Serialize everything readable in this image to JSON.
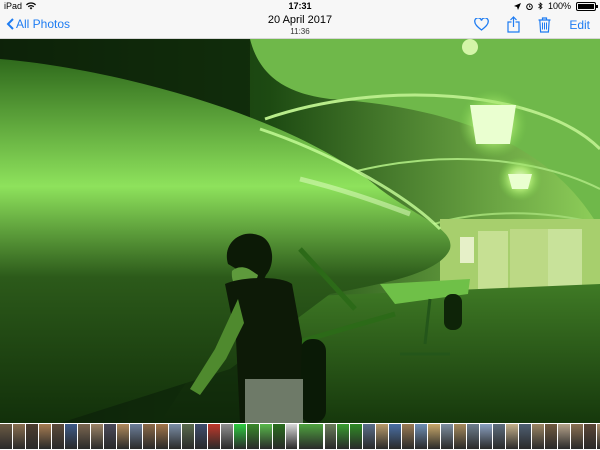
{
  "status_bar": {
    "device": "iPad",
    "time": "17:31",
    "battery": "100%",
    "battery_level": 1.0
  },
  "nav_bar": {
    "back_label": "All Photos",
    "date": "20 April 2017",
    "time": "11:36",
    "edit_label": "Edit"
  },
  "icons": {
    "back": "chevron-left-icon",
    "favorite": "heart-icon",
    "share": "share-icon",
    "delete": "trash-icon"
  },
  "colors": {
    "accent": "#1e7cf2",
    "bar_background": "#f7f7f7"
  },
  "filmstrip": {
    "thumbnails": [
      {
        "color": "#6b5a44"
      },
      {
        "color": "#8a6f50"
      },
      {
        "color": "#4d3d2f"
      },
      {
        "color": "#a67c52"
      },
      {
        "color": "#5c4a3a"
      },
      {
        "color": "#3e5a88"
      },
      {
        "color": "#7a6650"
      },
      {
        "color": "#9b8366"
      },
      {
        "color": "#4a4a5a"
      },
      {
        "color": "#b08a5c"
      },
      {
        "color": "#6d7f9a"
      },
      {
        "color": "#8c6a48"
      },
      {
        "color": "#a2754a"
      },
      {
        "color": "#7b8ea6"
      },
      {
        "color": "#5a6b4e"
      },
      {
        "color": "#3f4d6e"
      },
      {
        "color": "#c0392b"
      },
      {
        "color": "#8f8f8f"
      },
      {
        "color": "#2ecc40"
      },
      {
        "color": "#3a8a2a"
      },
      {
        "color": "#58b84a"
      },
      {
        "color": "#2a6e1e"
      },
      {
        "color": "#d8d8d8"
      },
      {
        "color": "#4fa33f",
        "current": true
      },
      {
        "color": "#6a7c5a"
      },
      {
        "color": "#3a9e30"
      },
      {
        "color": "#2f8a25"
      },
      {
        "color": "#5a6e8a"
      },
      {
        "color": "#b89a6a"
      },
      {
        "color": "#4a6fa5"
      },
      {
        "color": "#9a7b55"
      },
      {
        "color": "#6f8fb5"
      },
      {
        "color": "#c8a86a"
      },
      {
        "color": "#7d8ea0"
      },
      {
        "color": "#a68a5c"
      },
      {
        "color": "#6e7e8e"
      },
      {
        "color": "#8aa0c0"
      },
      {
        "color": "#5e6e7e"
      },
      {
        "color": "#c4b08a"
      },
      {
        "color": "#4f5f72"
      },
      {
        "color": "#9c8664"
      },
      {
        "color": "#705a40"
      },
      {
        "color": "#b5a28a"
      },
      {
        "color": "#8a7052"
      },
      {
        "color": "#5a4636"
      },
      {
        "color": "#a88e6c"
      }
    ]
  }
}
